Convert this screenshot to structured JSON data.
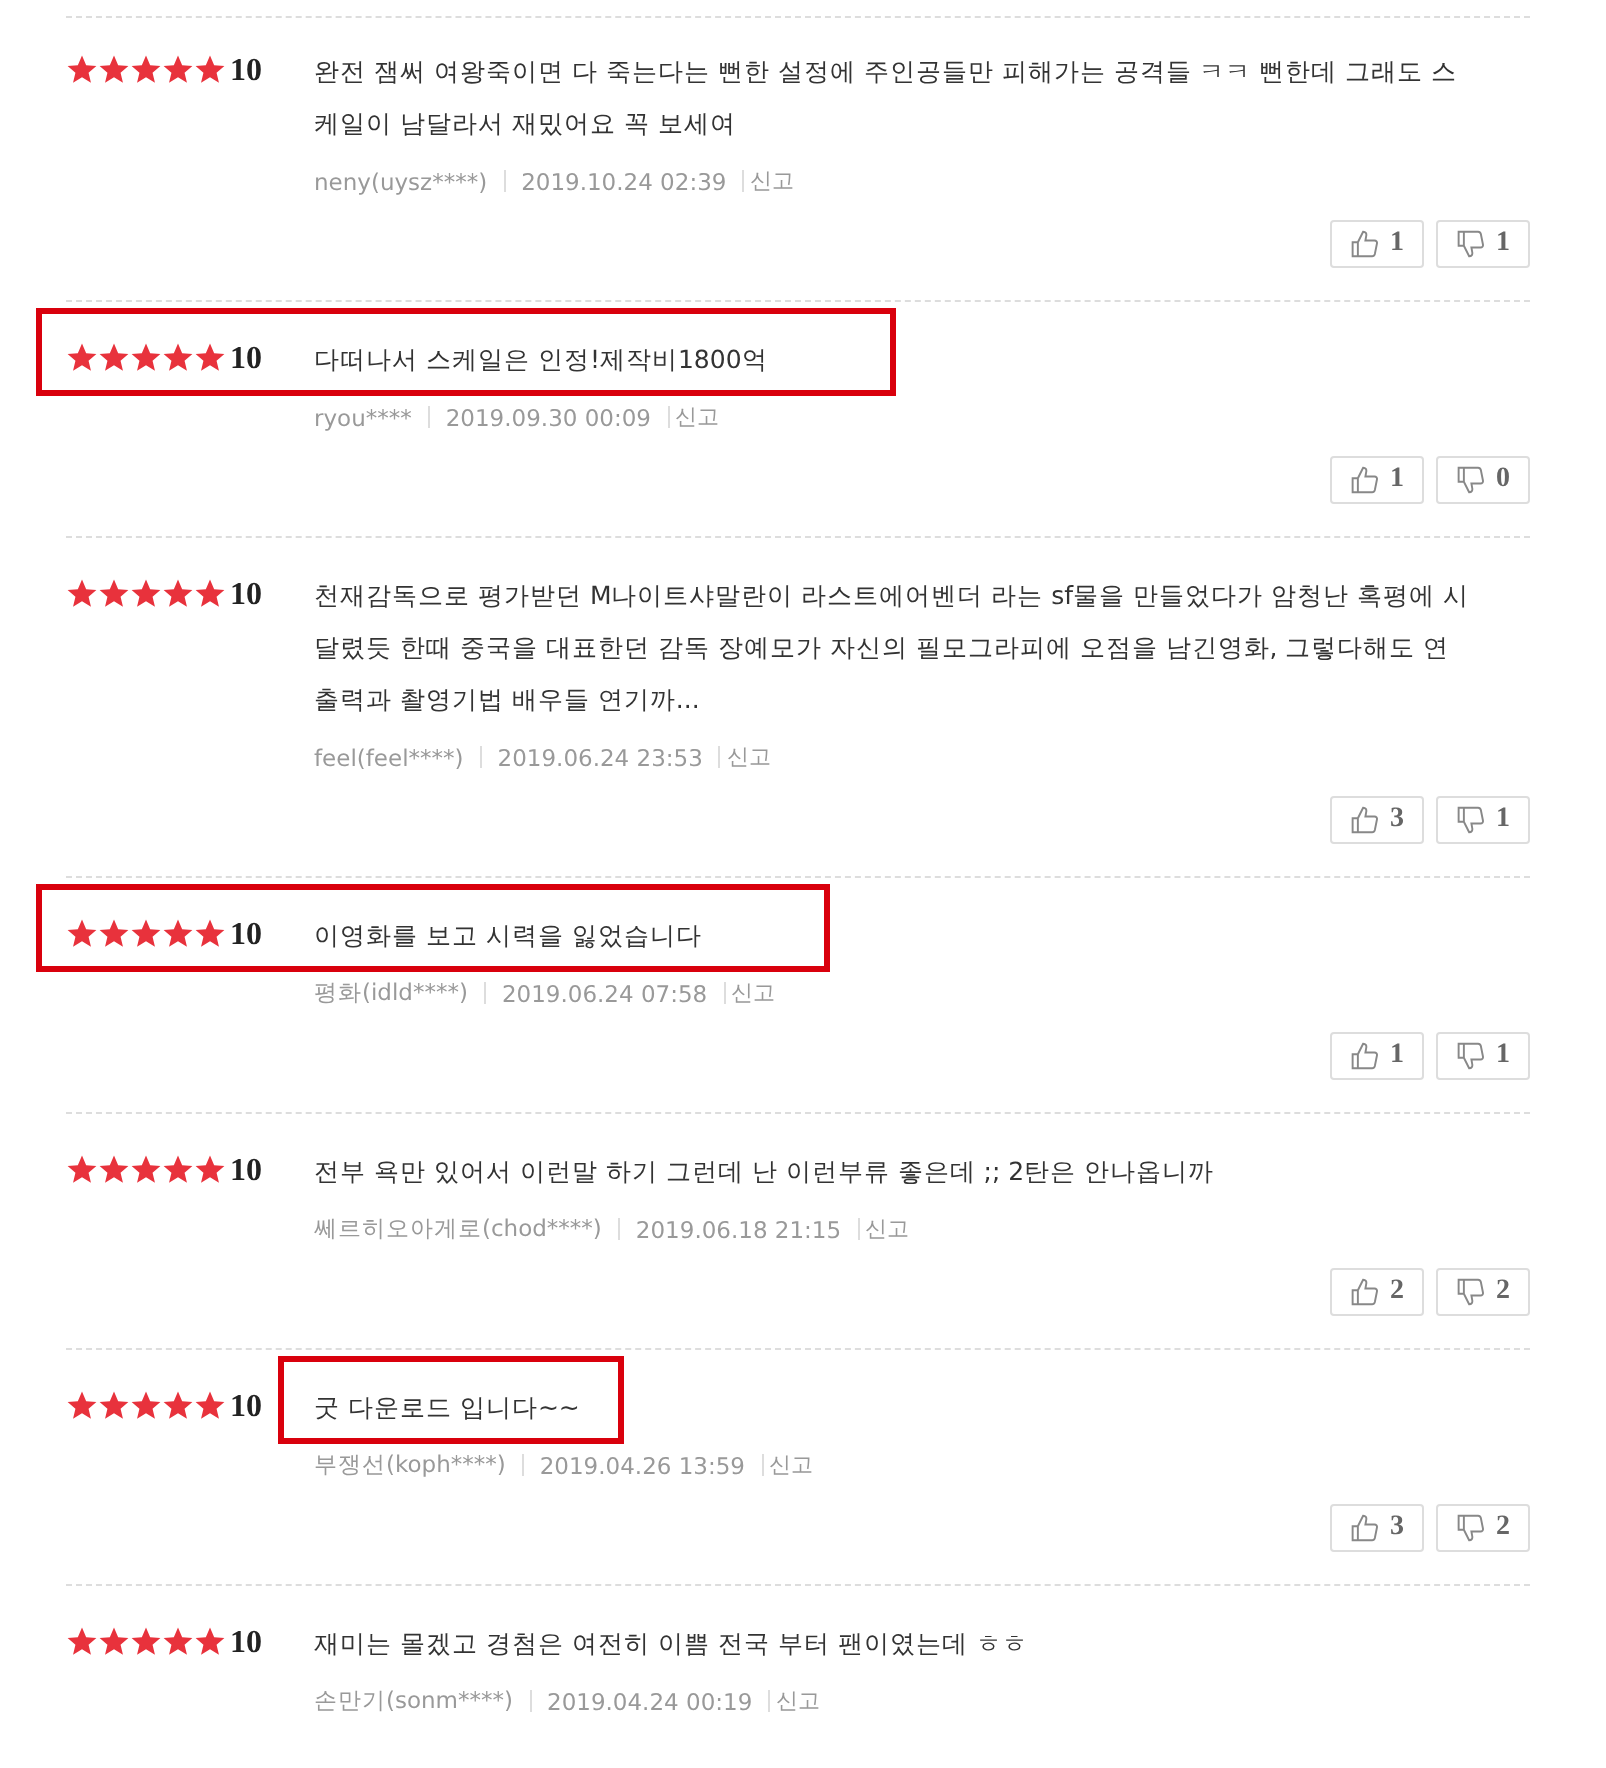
{
  "reviews": [
    {
      "stars": 5,
      "score": "10",
      "text": "완전 잼써 여왕죽이면 다 죽는다는 뻔한 설정에 주인공들만 피해가는 공격들 ㅋㅋ 뻔한데 그래도 스케일이 남달라서 재밌어요 꼭 보세여",
      "author": "neny(uysz****)",
      "date": "2019.10.24 02:39",
      "report": "신고",
      "likes": "1",
      "dislikes": "1"
    },
    {
      "stars": 5,
      "score": "10",
      "text": "다떠나서 스케일은 인정!제작비1800억",
      "author": "ryou****",
      "date": "2019.09.30 00:09",
      "report": "신고",
      "likes": "1",
      "dislikes": "0",
      "highlighted": true,
      "frame_covers_rating": true
    },
    {
      "stars": 5,
      "score": "10",
      "text": "천재감독으로 평가받던 M나이트샤말란이 라스트에어벤더 라는 sf물을 만들었다가 암청난 혹평에 시달렸듯 한때 중국을 대표한던 감독 장예모가 자신의 필모그라피에 오점을 남긴영화, 그렇다해도 연출력과 촬영기법 배우들 연기까...",
      "author": "feel(feel****)",
      "date": "2019.06.24 23:53",
      "report": "신고",
      "likes": "3",
      "dislikes": "1"
    },
    {
      "stars": 5,
      "score": "10",
      "text": "이영화를 보고 시력을 잃었습니다",
      "author": "평화(idld****)",
      "date": "2019.06.24 07:58",
      "report": "신고",
      "likes": "1",
      "dislikes": "1",
      "highlighted": true,
      "frame_covers_rating": true
    },
    {
      "stars": 5,
      "score": "10",
      "text": "전부 욕만 있어서 이런말 하기 그런데 난 이런부류 좋은데 ;; 2탄은 안나옵니까",
      "author": "쎄르히오아게로(chod****)",
      "date": "2019.06.18 21:15",
      "report": "신고",
      "likes": "2",
      "dislikes": "2"
    },
    {
      "stars": 5,
      "score": "10",
      "text": "굿 다운로드 입니다~~",
      "author": "부쟁선(koph****)",
      "date": "2019.04.26 13:59",
      "report": "신고",
      "likes": "3",
      "dislikes": "2",
      "highlighted": true,
      "frame_covers_rating": false
    },
    {
      "stars": 5,
      "score": "10",
      "text": "재미는 몰겠고 경첨은 여전히 이쁨 전국 부터 팬이였는데 ㅎㅎ",
      "author": "손만기(sonm****)",
      "date": "2019.04.24 00:19",
      "report": "신고"
    }
  ]
}
